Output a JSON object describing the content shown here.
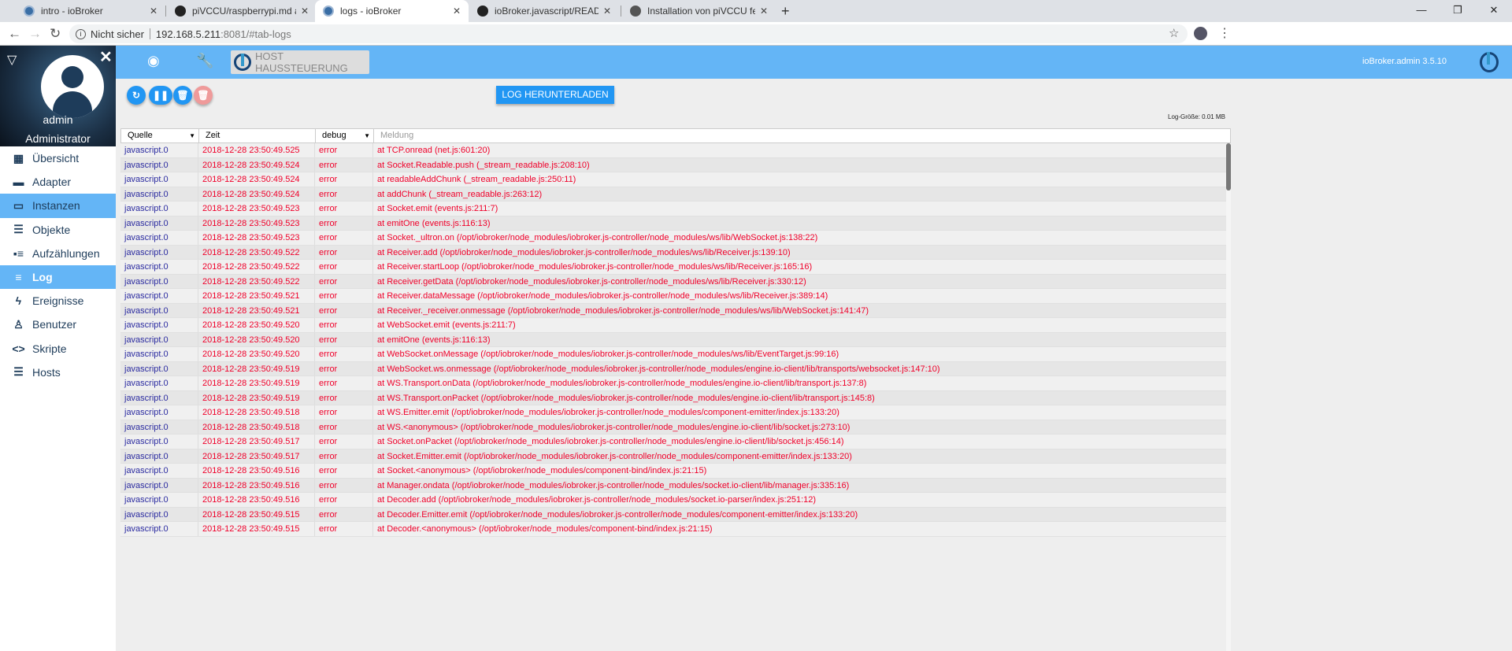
{
  "browser": {
    "tabs": [
      {
        "label": "intro - ioBroker",
        "icon": "iobroker-favicon"
      },
      {
        "label": "piVCCU/raspberrypi.md at maste",
        "icon": "github-icon"
      },
      {
        "label": "logs - ioBroker",
        "icon": "iobroker-favicon",
        "active": true
      },
      {
        "label": "ioBroker.javascript/README.md a",
        "icon": "github-icon"
      },
      {
        "label": "Installation von piVCCU fehlgesch",
        "icon": "plus-circle-icon"
      }
    ],
    "security": "Nicht sicher",
    "url_host": "192.168.5.211",
    "url_rest": ":8081/#tab-logs"
  },
  "sidebar": {
    "user": "admin",
    "role": "Administrator",
    "items": [
      {
        "label": "Übersicht",
        "icon": "grid-icon"
      },
      {
        "label": "Adapter",
        "icon": "store-icon"
      },
      {
        "label": "Instanzen",
        "icon": "subtitles-icon",
        "highlighted": true
      },
      {
        "label": "Objekte",
        "icon": "list-icon"
      },
      {
        "label": "Aufzählungen",
        "icon": "enum-icon"
      },
      {
        "label": "Log",
        "icon": "lines-icon",
        "active": true
      },
      {
        "label": "Ereignisse",
        "icon": "bolt-icon"
      },
      {
        "label": "Benutzer",
        "icon": "person-icon"
      },
      {
        "label": "Skripte",
        "icon": "code-icon"
      },
      {
        "label": "Hosts",
        "icon": "storage-icon"
      }
    ]
  },
  "header": {
    "host_button": "HOST HAUSSTEUERUNG",
    "version": "ioBroker.admin 3.5.10"
  },
  "toolbar": {
    "download": "LOG HERUNTERLADEN",
    "log_size": "Log-Größe: 0.01 MB"
  },
  "colors": {
    "accent": "#64b5f6",
    "button": "#2196f3",
    "error": "#f0002a",
    "source": "#2b2ba0"
  },
  "table": {
    "headers": {
      "source": "Quelle",
      "time": "Zeit",
      "level": "debug",
      "message": "Meldung"
    },
    "rows": [
      [
        "javascript.0",
        "2018-12-28 23:50:49.525",
        "error",
        "at TCP.onread (net.js:601:20)"
      ],
      [
        "javascript.0",
        "2018-12-28 23:50:49.524",
        "error",
        "at Socket.Readable.push (_stream_readable.js:208:10)"
      ],
      [
        "javascript.0",
        "2018-12-28 23:50:49.524",
        "error",
        "at readableAddChunk (_stream_readable.js:250:11)"
      ],
      [
        "javascript.0",
        "2018-12-28 23:50:49.524",
        "error",
        "at addChunk (_stream_readable.js:263:12)"
      ],
      [
        "javascript.0",
        "2018-12-28 23:50:49.523",
        "error",
        "at Socket.emit (events.js:211:7)"
      ],
      [
        "javascript.0",
        "2018-12-28 23:50:49.523",
        "error",
        "at emitOne (events.js:116:13)"
      ],
      [
        "javascript.0",
        "2018-12-28 23:50:49.523",
        "error",
        "at Socket._ultron.on (/opt/iobroker/node_modules/iobroker.js-controller/node_modules/ws/lib/WebSocket.js:138:22)"
      ],
      [
        "javascript.0",
        "2018-12-28 23:50:49.522",
        "error",
        "at Receiver.add (/opt/iobroker/node_modules/iobroker.js-controller/node_modules/ws/lib/Receiver.js:139:10)"
      ],
      [
        "javascript.0",
        "2018-12-28 23:50:49.522",
        "error",
        "at Receiver.startLoop (/opt/iobroker/node_modules/iobroker.js-controller/node_modules/ws/lib/Receiver.js:165:16)"
      ],
      [
        "javascript.0",
        "2018-12-28 23:50:49.522",
        "error",
        "at Receiver.getData (/opt/iobroker/node_modules/iobroker.js-controller/node_modules/ws/lib/Receiver.js:330:12)"
      ],
      [
        "javascript.0",
        "2018-12-28 23:50:49.521",
        "error",
        "at Receiver.dataMessage (/opt/iobroker/node_modules/iobroker.js-controller/node_modules/ws/lib/Receiver.js:389:14)"
      ],
      [
        "javascript.0",
        "2018-12-28 23:50:49.521",
        "error",
        "at Receiver._receiver.onmessage (/opt/iobroker/node_modules/iobroker.js-controller/node_modules/ws/lib/WebSocket.js:141:47)"
      ],
      [
        "javascript.0",
        "2018-12-28 23:50:49.520",
        "error",
        "at WebSocket.emit (events.js:211:7)"
      ],
      [
        "javascript.0",
        "2018-12-28 23:50:49.520",
        "error",
        "at emitOne (events.js:116:13)"
      ],
      [
        "javascript.0",
        "2018-12-28 23:50:49.520",
        "error",
        "at WebSocket.onMessage (/opt/iobroker/node_modules/iobroker.js-controller/node_modules/ws/lib/EventTarget.js:99:16)"
      ],
      [
        "javascript.0",
        "2018-12-28 23:50:49.519",
        "error",
        "at WebSocket.ws.onmessage (/opt/iobroker/node_modules/iobroker.js-controller/node_modules/engine.io-client/lib/transports/websocket.js:147:10)"
      ],
      [
        "javascript.0",
        "2018-12-28 23:50:49.519",
        "error",
        "at WS.Transport.onData (/opt/iobroker/node_modules/iobroker.js-controller/node_modules/engine.io-client/lib/transport.js:137:8)"
      ],
      [
        "javascript.0",
        "2018-12-28 23:50:49.519",
        "error",
        "at WS.Transport.onPacket (/opt/iobroker/node_modules/iobroker.js-controller/node_modules/engine.io-client/lib/transport.js:145:8)"
      ],
      [
        "javascript.0",
        "2018-12-28 23:50:49.518",
        "error",
        "at WS.Emitter.emit (/opt/iobroker/node_modules/iobroker.js-controller/node_modules/component-emitter/index.js:133:20)"
      ],
      [
        "javascript.0",
        "2018-12-28 23:50:49.518",
        "error",
        "at WS.<anonymous> (/opt/iobroker/node_modules/iobroker.js-controller/node_modules/engine.io-client/lib/socket.js:273:10)"
      ],
      [
        "javascript.0",
        "2018-12-28 23:50:49.517",
        "error",
        "at Socket.onPacket (/opt/iobroker/node_modules/iobroker.js-controller/node_modules/engine.io-client/lib/socket.js:456:14)"
      ],
      [
        "javascript.0",
        "2018-12-28 23:50:49.517",
        "error",
        "at Socket.Emitter.emit (/opt/iobroker/node_modules/iobroker.js-controller/node_modules/component-emitter/index.js:133:20)"
      ],
      [
        "javascript.0",
        "2018-12-28 23:50:49.516",
        "error",
        "at Socket.<anonymous> (/opt/iobroker/node_modules/component-bind/index.js:21:15)"
      ],
      [
        "javascript.0",
        "2018-12-28 23:50:49.516",
        "error",
        "at Manager.ondata (/opt/iobroker/node_modules/iobroker.js-controller/node_modules/socket.io-client/lib/manager.js:335:16)"
      ],
      [
        "javascript.0",
        "2018-12-28 23:50:49.516",
        "error",
        "at Decoder.add (/opt/iobroker/node_modules/iobroker.js-controller/node_modules/socket.io-parser/index.js:251:12)"
      ],
      [
        "javascript.0",
        "2018-12-28 23:50:49.515",
        "error",
        "at Decoder.Emitter.emit (/opt/iobroker/node_modules/iobroker.js-controller/node_modules/component-emitter/index.js:133:20)"
      ],
      [
        "javascript.0",
        "2018-12-28 23:50:49.515",
        "error",
        "at Decoder.<anonymous> (/opt/iobroker/node_modules/component-bind/index.js:21:15)"
      ]
    ]
  }
}
